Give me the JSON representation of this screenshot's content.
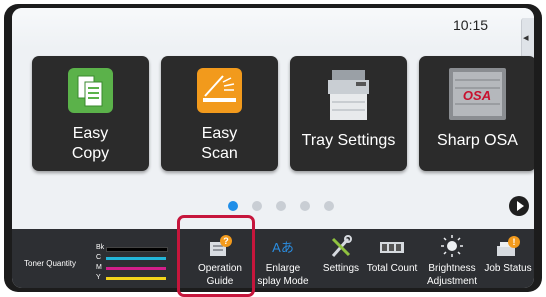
{
  "status_bar": {
    "time": "10:15",
    "side_tab_glyph": "◂"
  },
  "tiles": [
    {
      "label": "Easy\nCopy",
      "icon": "copy-icon",
      "color": "#5bb24a"
    },
    {
      "label": "Easy\nScan",
      "icon": "scan-icon",
      "color": "#f29a1c"
    },
    {
      "label": "Tray Settings",
      "icon": "printer-icon"
    },
    {
      "label": "Sharp OSA",
      "icon": "osa-icon",
      "logo_text": "OSA"
    }
  ],
  "pager": {
    "pages": 5,
    "active": 0
  },
  "toner": {
    "label": "Toner Quantity",
    "bars": [
      {
        "name": "Bk",
        "color": "#000000"
      },
      {
        "name": "C",
        "color": "#23b6d9"
      },
      {
        "name": "M",
        "color": "#d21f8a"
      },
      {
        "name": "Y",
        "color": "#f2d21b"
      }
    ]
  },
  "functions": [
    {
      "label": "Operation\nGuide",
      "icon": "operation-guide-icon"
    },
    {
      "label": "Enlarge\nsplay Mode",
      "icon": "enlarge-display-icon",
      "icon_text": "Aあ"
    },
    {
      "label": "Settings",
      "icon": "settings-icon"
    },
    {
      "label": "Total Count",
      "icon": "total-count-icon"
    },
    {
      "label": "Brightness\nAdjustment",
      "icon": "brightness-icon"
    },
    {
      "label": "Job Status",
      "icon": "job-status-icon"
    }
  ]
}
